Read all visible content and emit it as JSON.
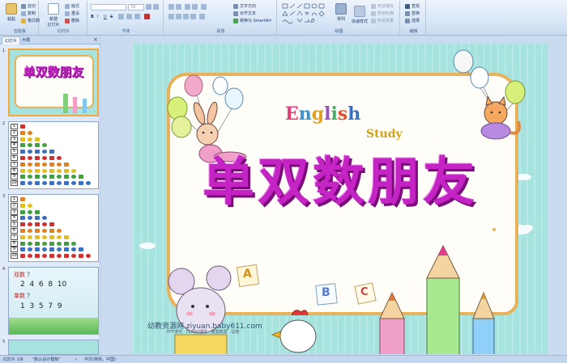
{
  "ribbon": {
    "clipboard": {
      "paste": "粘贴",
      "cut": "剪切",
      "copy": "复制",
      "format_painter": "格式刷",
      "group_label": "剪贴板"
    },
    "slides": {
      "new_slide": "新建\n幻灯片",
      "layout": "版式",
      "reset": "重设",
      "delete": "删除",
      "group_label": "幻灯片"
    },
    "font": {
      "font_name": "",
      "font_size": "72",
      "bold": "B",
      "italic": "I",
      "underline": "U",
      "strike": "S",
      "group_label": "字体"
    },
    "paragraph": {
      "text_direction": "文字方向",
      "align_text": "对齐文本",
      "convert_smartart": "转换为 SmartArt",
      "group_label": "段落"
    },
    "drawing": {
      "arrange": "排列",
      "quick_styles": "快速样式",
      "shape_fill": "形状填充",
      "shape_outline": "形状轮廓",
      "shape_effects": "形状效果",
      "group_label": "绘图"
    },
    "editing": {
      "find": "查找",
      "replace": "替换",
      "select": "选择",
      "group_label": "编辑"
    }
  },
  "panel": {
    "tab_slides": "幻灯片",
    "tab_outline": "大纲",
    "close": "×",
    "thumbnails": [
      {
        "number": "1",
        "title": "单双数朋友"
      },
      {
        "number": "2",
        "rows": [
          "1",
          "2",
          "3",
          "4",
          "5",
          "6",
          "7",
          "8",
          "9",
          "10"
        ]
      },
      {
        "number": "3",
        "rows": [
          "1",
          "2",
          "3",
          "4",
          "5",
          "6",
          "7",
          "8",
          "9",
          "10"
        ]
      },
      {
        "number": "4",
        "line1_label": "双数",
        "line1_q": "？",
        "line1_values": "2  4  6  8  10",
        "line2_label": "单数",
        "line2_q": "？",
        "line2_values": "1  3  5  7  9"
      },
      {
        "number": "5"
      }
    ]
  },
  "slide": {
    "title": "单双数朋友",
    "english": "English",
    "study": "Study",
    "letter_a": "A",
    "letter_b": "B",
    "letter_c": "C",
    "brand": "幼教资源网 ziyuan.baby611.com",
    "brand_sub": "PPT课件 · FLASH课件 · 教案教案 · 试卷"
  },
  "status": {
    "slide_count": "幻灯片 1/6",
    "theme": "\"默认设计模板\"",
    "language": "中文(简体，中国)"
  },
  "colors": {
    "accent_title": "#c524c4",
    "slide_bg": "#a6e3df",
    "frame": "#e7b25b",
    "ribbon_bg": "#d6e5f6"
  }
}
